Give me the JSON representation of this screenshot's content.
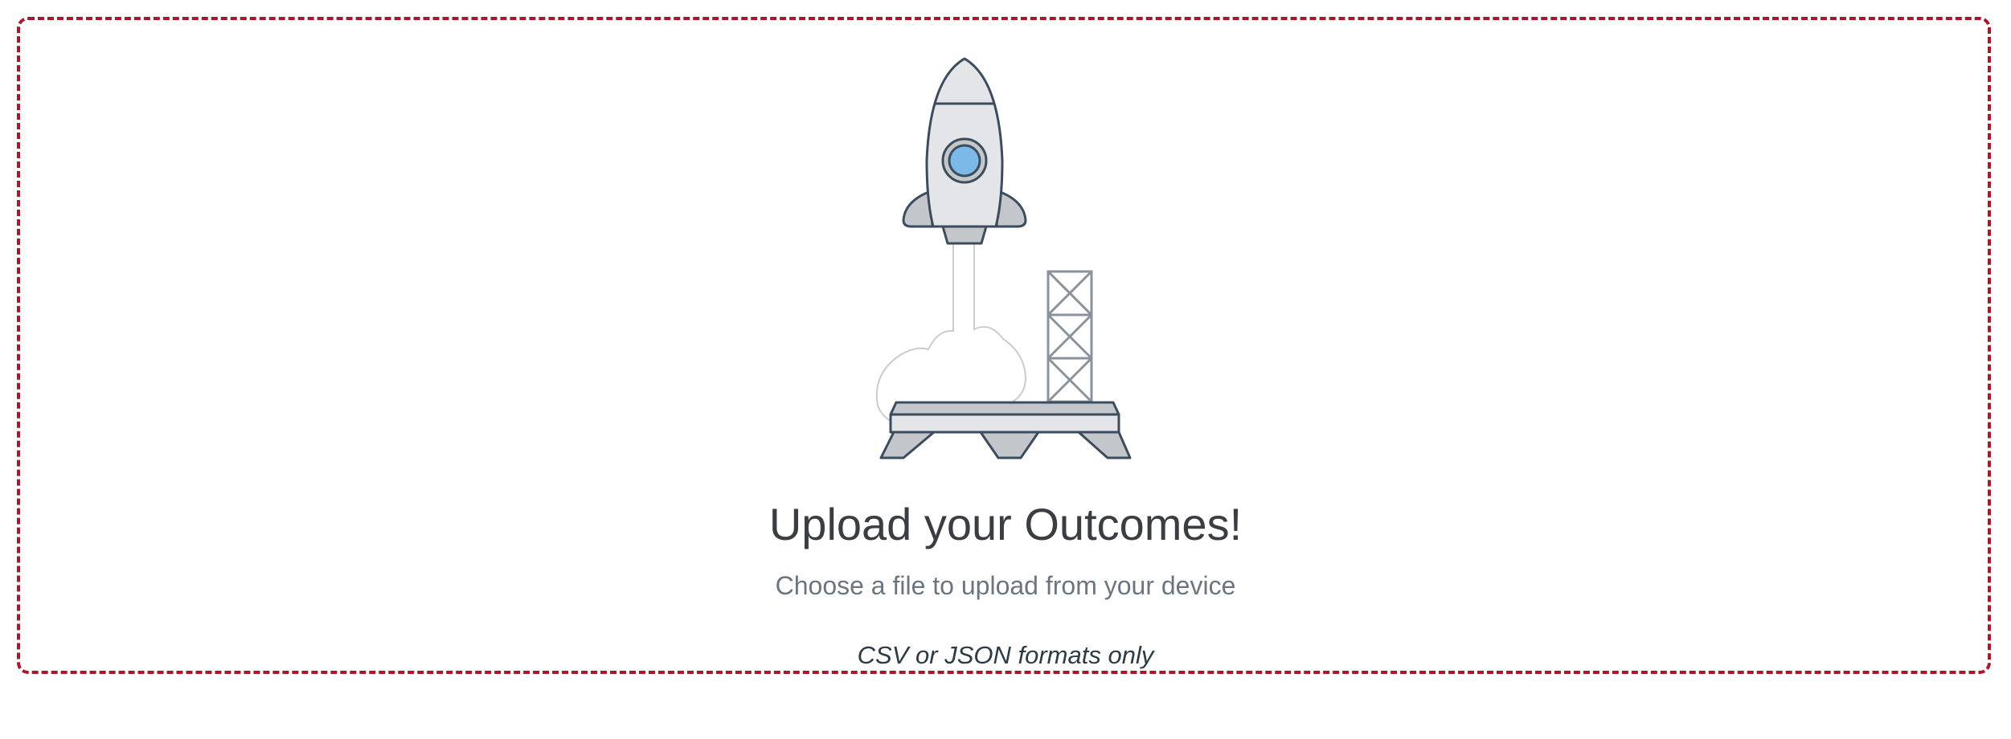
{
  "upload": {
    "title": "Upload your Outcomes!",
    "subtitle": "Choose a file to upload from your device",
    "formats_note": "CSV or JSON formats only",
    "illustration_icon": "rocket-launch-icon"
  },
  "colors": {
    "dropzone_border": "#a5192b",
    "title_text": "#3a3d42",
    "subtitle_text": "#6b7580",
    "note_text": "#2d3b45",
    "rocket_window": "#7cb9e8",
    "outline": "#3d4c5c",
    "fill_light": "#e3e5e8",
    "fill_mid": "#c3c7cc"
  }
}
